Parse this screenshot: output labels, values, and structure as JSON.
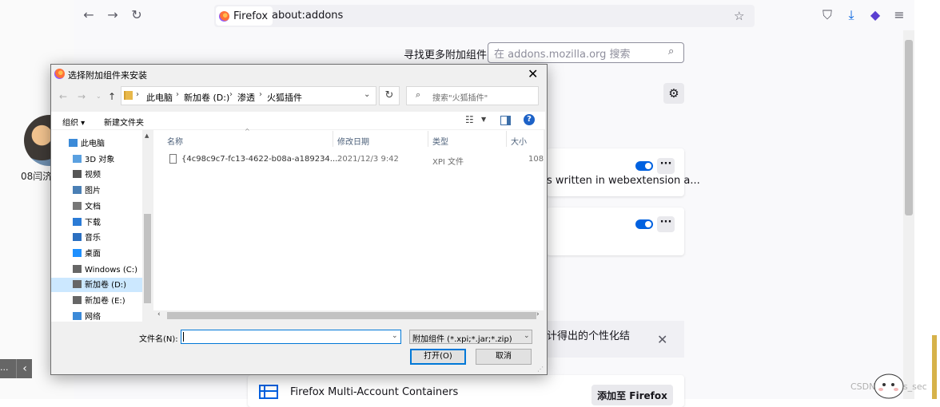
{
  "browser": {
    "identity_label": "Firefox",
    "url": "about:addons"
  },
  "addons_page": {
    "find_more_label": "寻找更多附加组件",
    "search_placeholder": "在 addons.mozilla.org 搜索",
    "card1_description": "s written in webextension a...",
    "banner_text": "计得出的个性化结",
    "recommended_name": "Firefox Multi-Account Containers",
    "recommended_button": "添加至 Firefox"
  },
  "left_panel": {
    "name": "08闫济",
    "button_dots": "..."
  },
  "dialog": {
    "title": "选择附加组件来安装",
    "breadcrumbs": [
      "此电脑",
      "新加卷 (D:)",
      "渗透",
      "火狐插件"
    ],
    "search_placeholder": "搜索\"火狐插件\"",
    "organize_label": "组织 ▾",
    "new_folder_label": "新建文件夹",
    "tree": [
      {
        "label": "此电脑",
        "icon": "computer-icon"
      },
      {
        "label": "3D 对象",
        "icon": "cube-icon"
      },
      {
        "label": "视频",
        "icon": "video-icon"
      },
      {
        "label": "图片",
        "icon": "picture-icon"
      },
      {
        "label": "文档",
        "icon": "document-icon"
      },
      {
        "label": "下载",
        "icon": "download-icon"
      },
      {
        "label": "音乐",
        "icon": "music-icon"
      },
      {
        "label": "桌面",
        "icon": "desktop-icon"
      },
      {
        "label": "Windows (C:)",
        "icon": "drive-icon"
      },
      {
        "label": "新加卷 (D:)",
        "icon": "drive-icon",
        "selected": true
      },
      {
        "label": "新加卷 (E:)",
        "icon": "drive-icon"
      },
      {
        "label": "网络",
        "icon": "network-icon"
      }
    ],
    "columns": [
      "名称",
      "修改日期",
      "类型",
      "大小"
    ],
    "files": [
      {
        "name": "{4c98c9c7-fc13-4622-b08a-a189234...",
        "date": "2021/12/3 9:42",
        "type": "XPI 文件",
        "size": "108"
      }
    ],
    "filename_label": "文件名(N):",
    "filename_value": "",
    "filter_label": "附加组件 (*.xpi;*.jar;*.zip)",
    "open_button": "打开(O)",
    "cancel_button": "取消"
  },
  "watermark": "CSDN @yyds_sec",
  "colors": {
    "toggle_on": "#0061e0",
    "selection": "#cce8ff",
    "focus": "#0078d7"
  }
}
